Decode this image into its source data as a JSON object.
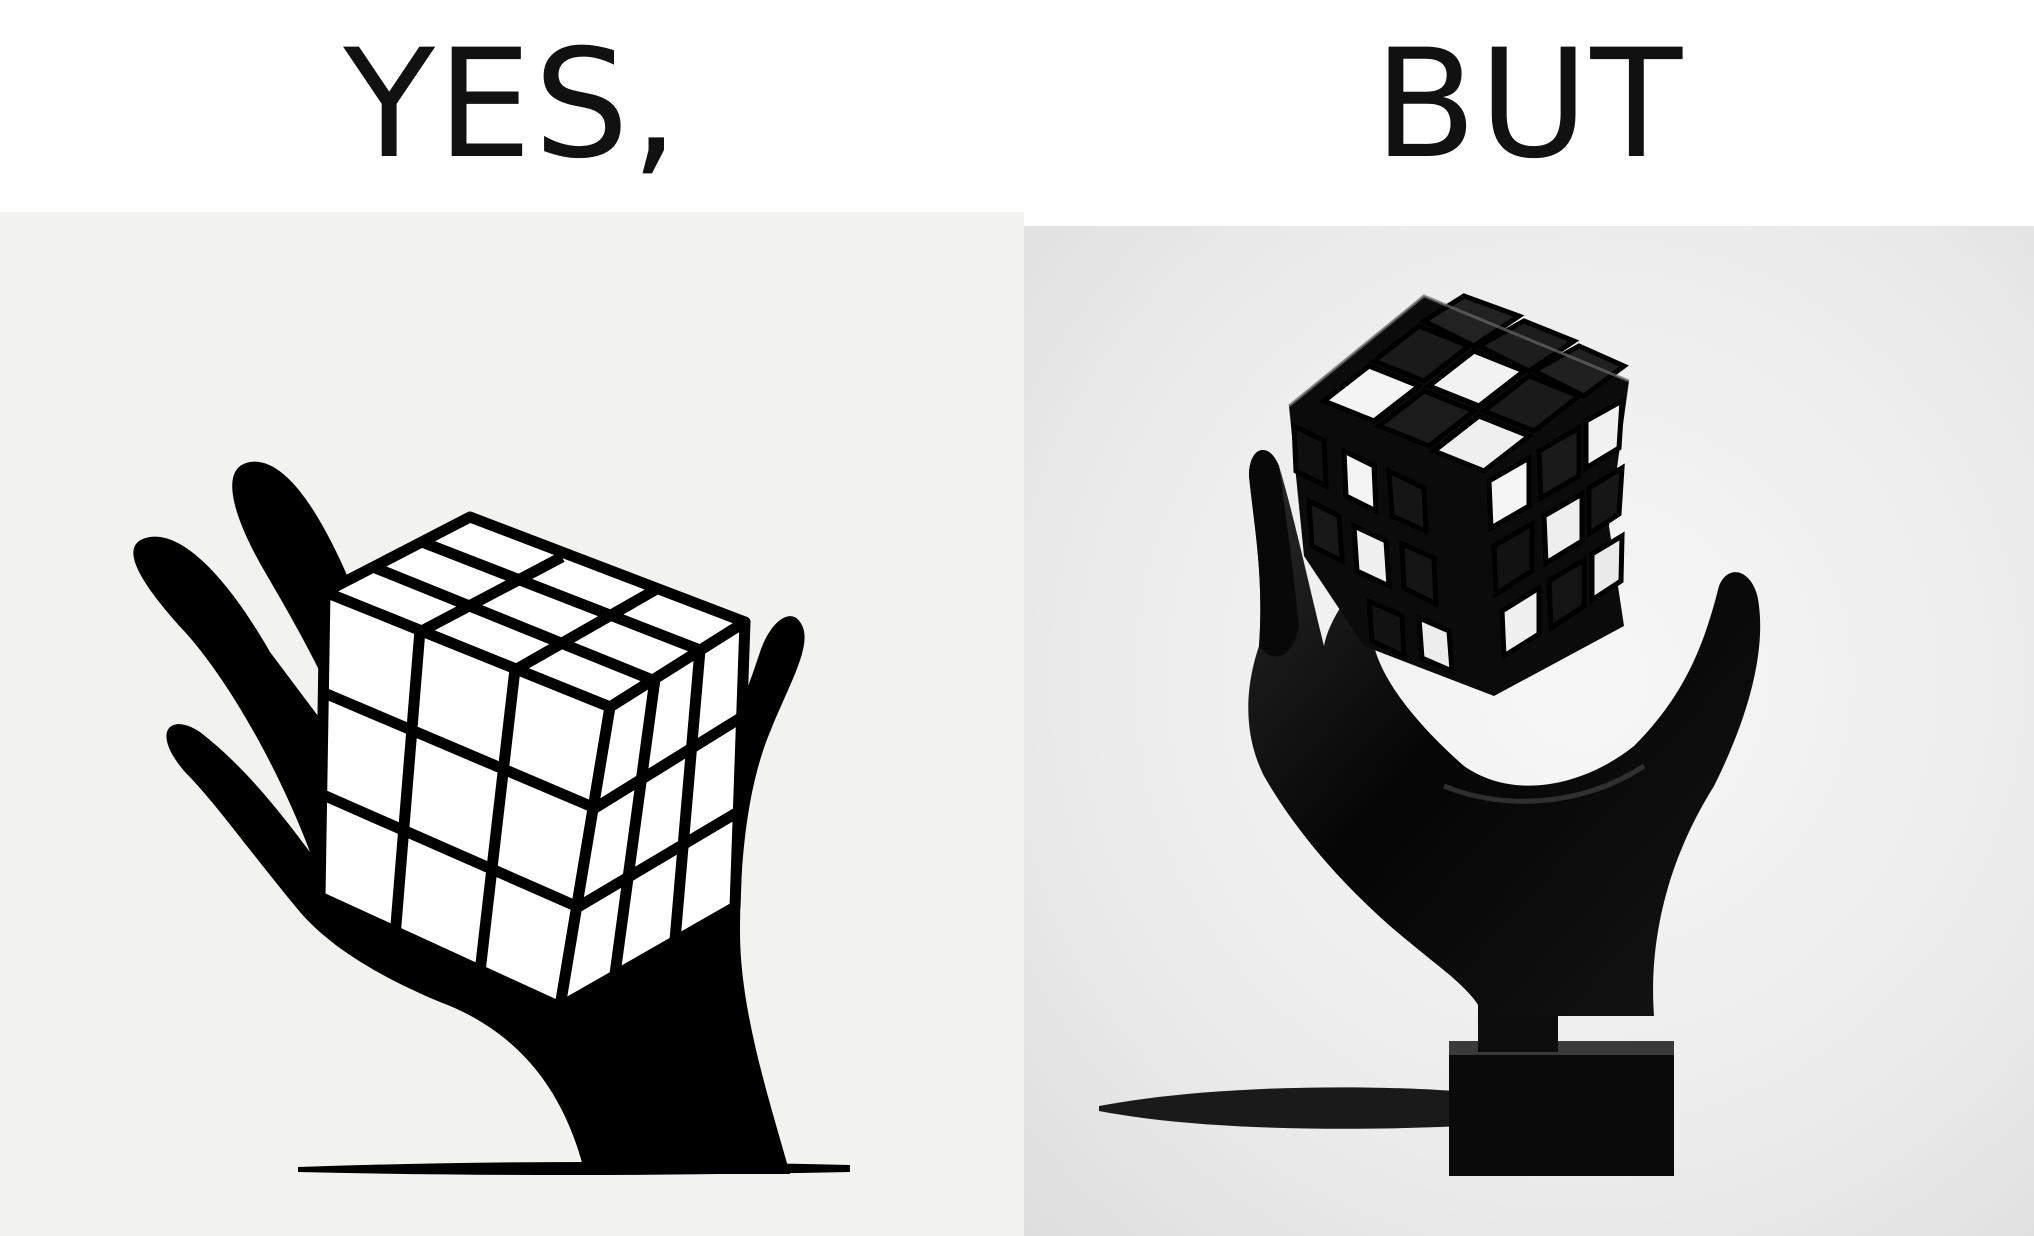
{
  "captions": {
    "left": "YES,",
    "right": "BUT"
  },
  "panels": {
    "left": {
      "scene": "flat-silhouette-hand-with-solved-cube",
      "hand_color": "#000000",
      "cube_face_color": "#ffffff"
    },
    "right": {
      "scene": "sculpted-hand-with-scrambled-cube",
      "hand_color": "#0a0a0a",
      "background": "#ececec"
    }
  },
  "colors": {
    "page_background": "#ffffff",
    "caption_text": "#111111"
  }
}
